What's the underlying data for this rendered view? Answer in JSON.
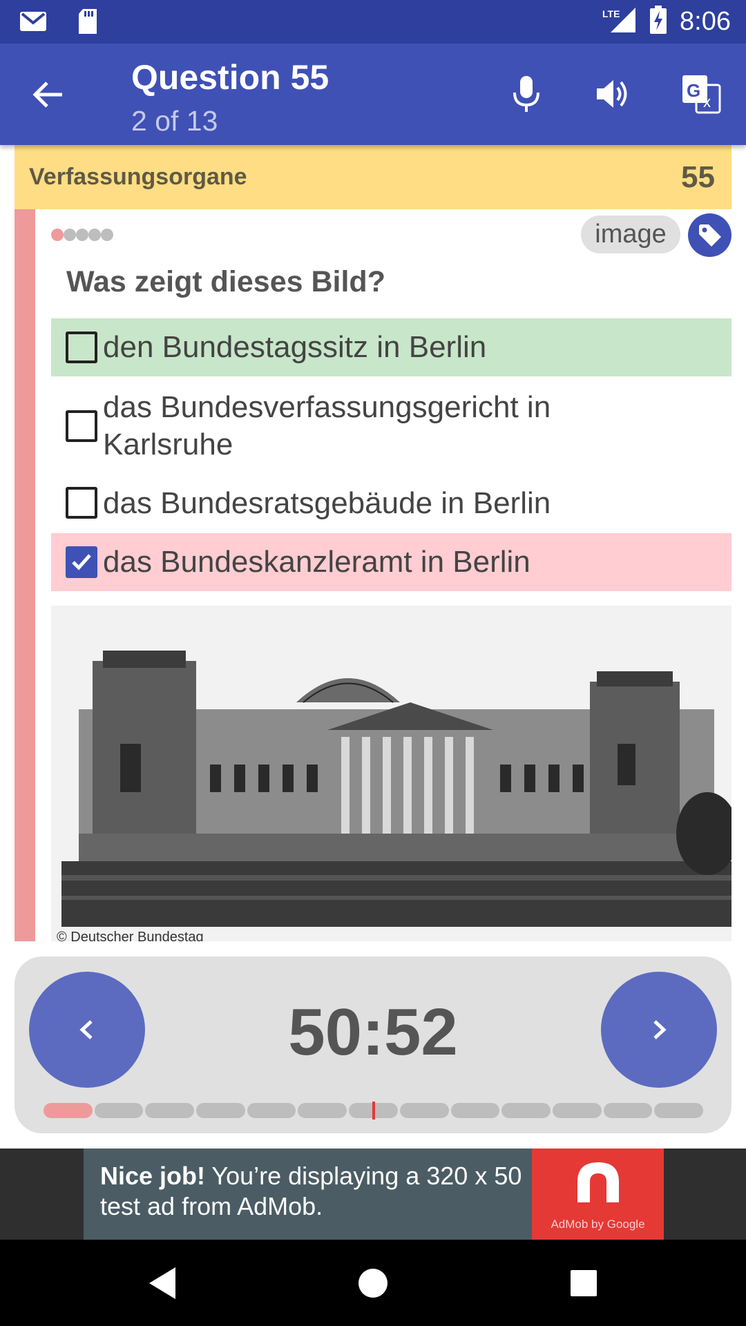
{
  "status_bar": {
    "time": "8:06",
    "network": "LTE",
    "icons": [
      "gmail-icon",
      "sd-card-icon",
      "signal-icon",
      "battery-charging-icon"
    ]
  },
  "app_bar": {
    "title": "Question 55",
    "subtitle": "2 of 13",
    "actions": [
      "microphone-icon",
      "volume-icon",
      "translate-icon"
    ]
  },
  "category": {
    "name": "Verfassungsorgane",
    "number": "55"
  },
  "question": {
    "difficulty_dots_total": 5,
    "difficulty_dots_filled": 1,
    "tag": "image",
    "text": "Was zeigt dieses Bild?",
    "answers": [
      {
        "label": "den Bundestagssitz in Berlin",
        "checked": false,
        "state": "correct"
      },
      {
        "label": "das Bundesverfassungsgericht in Karlsruhe",
        "checked": false,
        "state": "neutral"
      },
      {
        "label": "das Bundesratsgebäude in Berlin",
        "checked": false,
        "state": "neutral"
      },
      {
        "label": "das Bundeskanzleramt in Berlin",
        "checked": true,
        "state": "wrong"
      }
    ],
    "image_credit": "© Deutscher Bundestag"
  },
  "controls": {
    "timer": "50:52",
    "progress_total": 13,
    "progress_current": 2,
    "prev_icon": "chevron-left-icon",
    "next_icon": "chevron-right-icon"
  },
  "ad": {
    "bold": "Nice job!",
    "text": " You’re displaying a 320 x 50 test ad from AdMob.",
    "brand": "AdMob by Google"
  },
  "colors": {
    "primary": "#3f51b5",
    "primary_dark": "#2e3f9e",
    "category_bg": "#fedd84",
    "correct_bg": "#c8e6c9",
    "wrong_bg": "#ffcdd2",
    "wrong_accent": "#ef9a9a"
  }
}
